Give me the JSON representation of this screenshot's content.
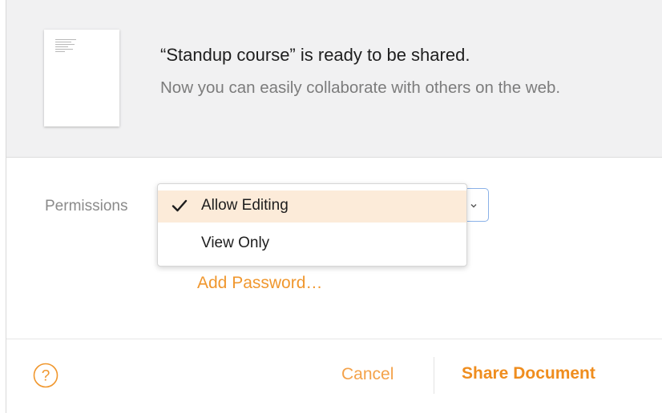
{
  "header": {
    "title": "“Standup course” is ready to be shared.",
    "subtitle": "Now you can easily collaborate with others on the web."
  },
  "permissions": {
    "label": "Permissions",
    "options": [
      {
        "label": "Allow Editing",
        "selected": true
      },
      {
        "label": "View Only",
        "selected": false
      }
    ],
    "chevron_icon": "chevron-down-icon",
    "check_icon": "checkmark-icon"
  },
  "add_password": "Add Password…",
  "footer": {
    "help_icon": "question-mark-icon",
    "cancel_label": "Cancel",
    "share_label": "Share Document"
  },
  "colors": {
    "accent": "#ef8d1e",
    "selected_row": "#fcebd9",
    "focus_ring": "#8ab1e8"
  }
}
